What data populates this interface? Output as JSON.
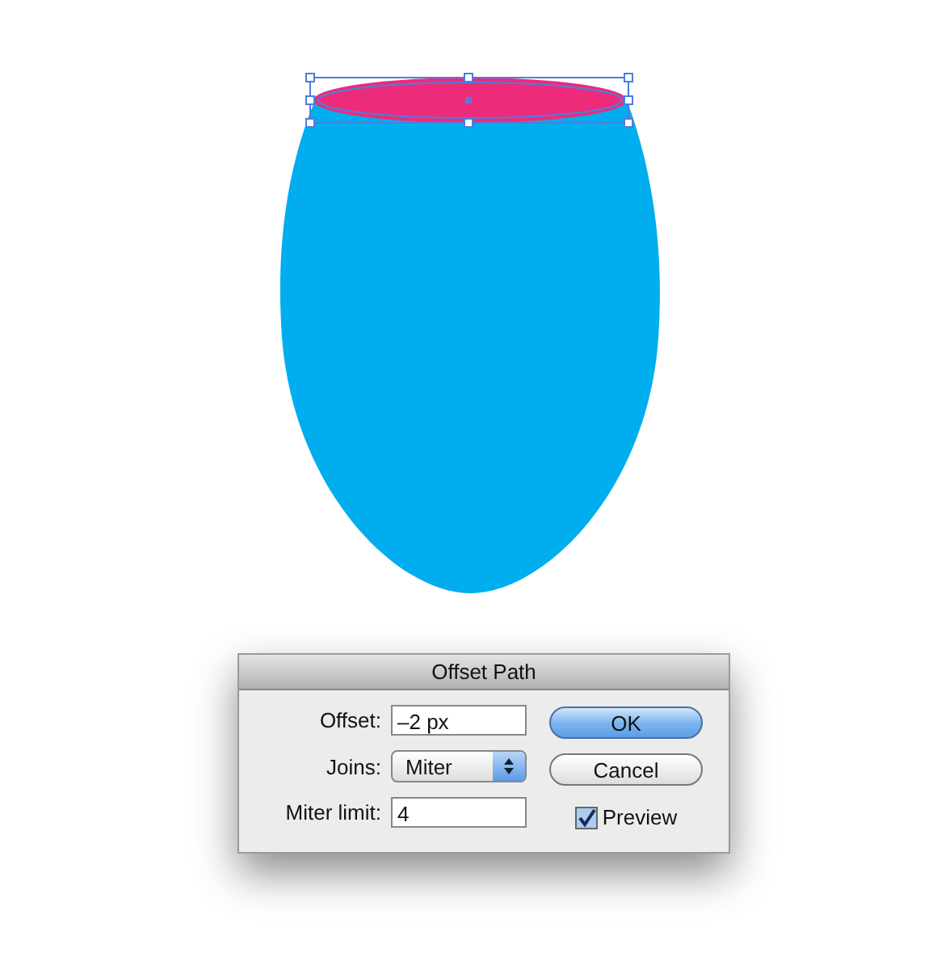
{
  "dialog": {
    "title": "Offset Path",
    "fields": [
      {
        "kind": "text",
        "label": "Offset:",
        "value": "–2 px"
      },
      {
        "kind": "select",
        "label": "Joins:",
        "value": "Miter"
      },
      {
        "kind": "text",
        "label": "Miter limit:",
        "value": "4"
      }
    ],
    "buttons": [
      {
        "label": "OK",
        "default": true
      },
      {
        "label": "Cancel",
        "default": false
      }
    ],
    "preview": {
      "label": "Preview",
      "checked": true
    }
  }
}
